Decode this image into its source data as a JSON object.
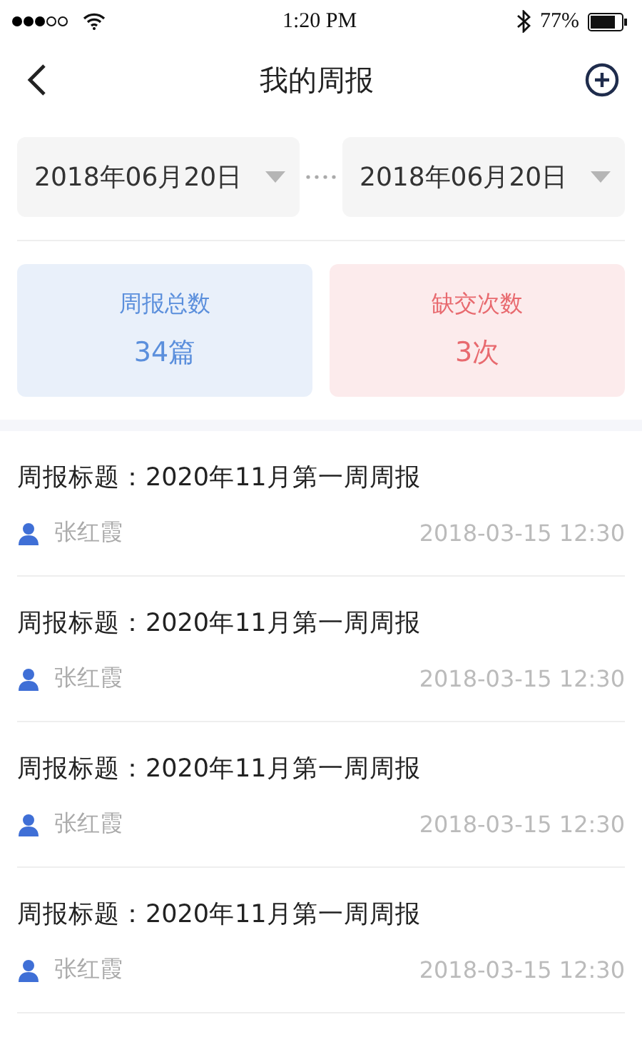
{
  "status_bar": {
    "time": "1:20 PM",
    "battery": "77%"
  },
  "nav": {
    "title": "我的周报"
  },
  "date_range": [
    {
      "value": "2018年06月20日"
    },
    {
      "value": "2018年06月20日"
    }
  ],
  "stats": [
    {
      "label": "周报总数",
      "value": "34篇",
      "color": "#5b8fdc"
    },
    {
      "label": "缺交次数",
      "value": "3次",
      "color": "#e86a6f"
    }
  ],
  "reports": [
    {
      "title": "周报标题：2020年11月第一周周报",
      "author": "张红霞",
      "time": "2018-03-15 12:30"
    },
    {
      "title": "周报标题：2020年11月第一周周报",
      "author": "张红霞",
      "time": "2018-03-15 12:30"
    },
    {
      "title": "周报标题：2020年11月第一周周报",
      "author": "张红霞",
      "time": "2018-03-15 12:30"
    },
    {
      "title": "周报标题：2020年11月第一周周报",
      "author": "张红霞",
      "time": "2018-03-15 12:30"
    }
  ]
}
